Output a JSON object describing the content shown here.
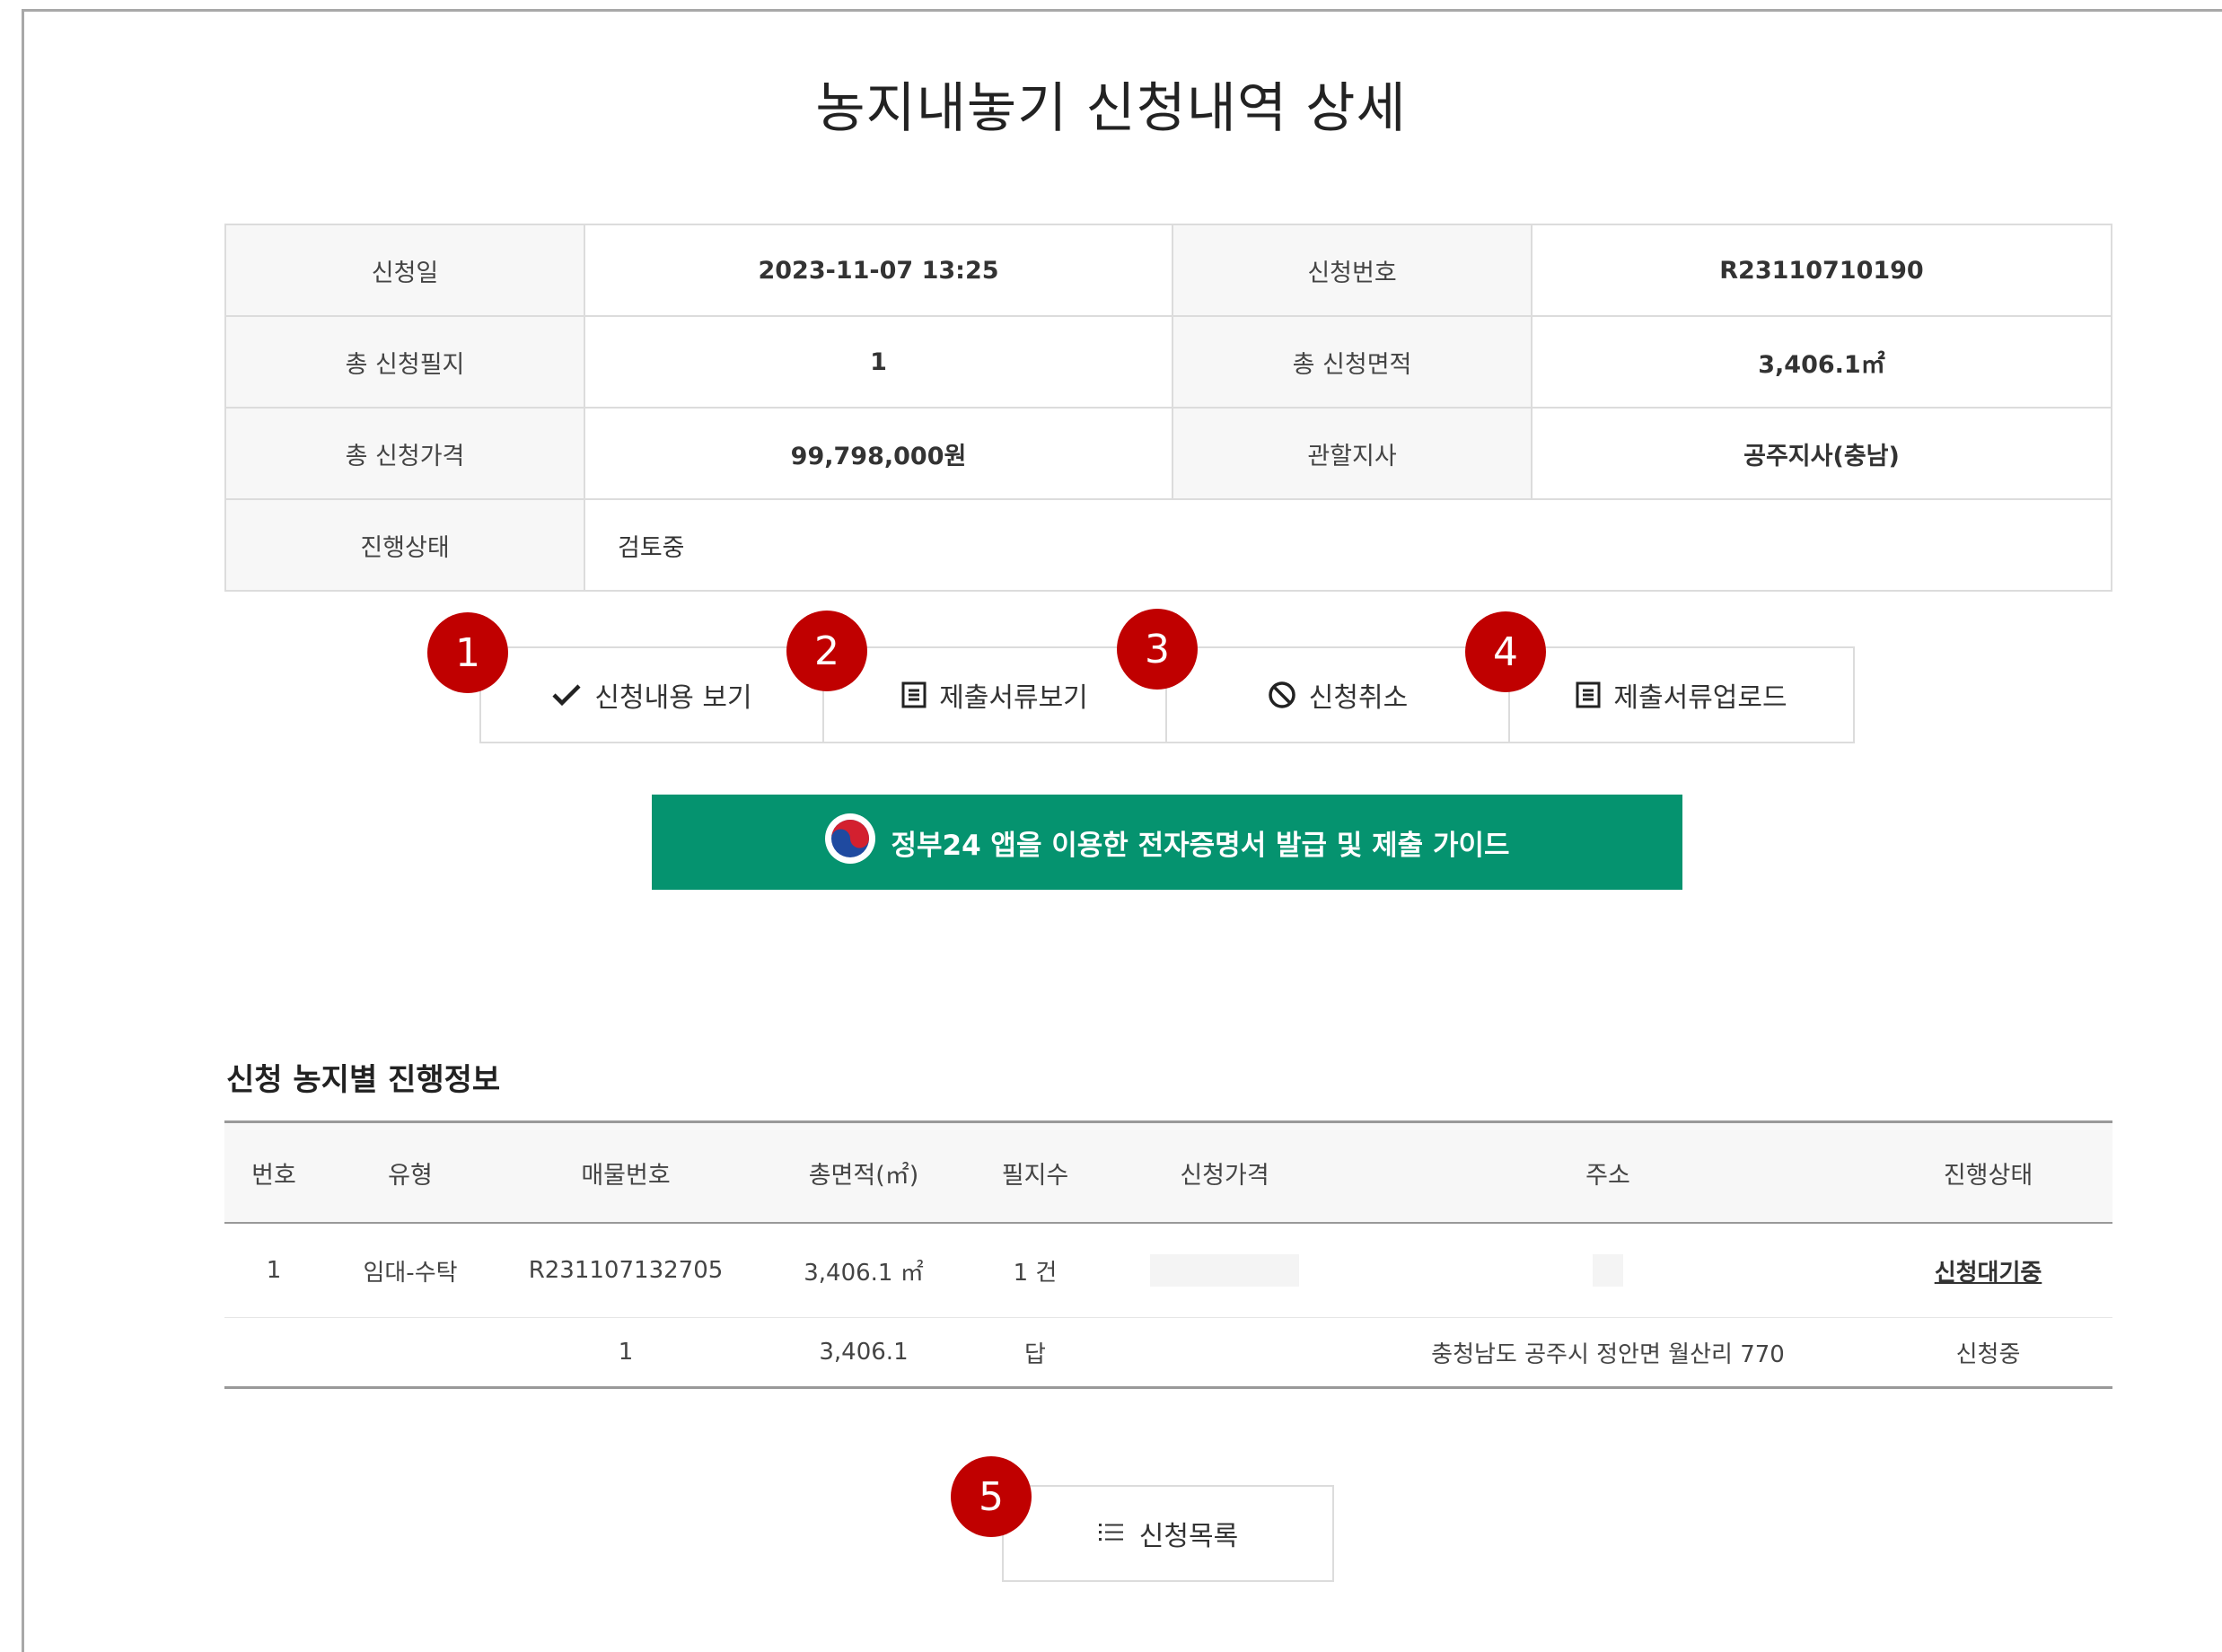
{
  "page": {
    "title": "농지내놓기 신청내역 상세"
  },
  "info": {
    "apply_date_label": "신청일",
    "apply_date": "2023-11-07 13:25",
    "apply_no_label": "신청번호",
    "apply_no": "R23110710190",
    "total_parcels_label": "총 신청필지",
    "total_parcels": "1",
    "total_area_label": "총 신청면적",
    "total_area": "3,406.1㎡",
    "total_price_label": "총 신청가격",
    "total_price": "99,798,000원",
    "branch_label": "관할지사",
    "branch": "공주지사(충남)",
    "status_label": "진행상태",
    "status": "검토중"
  },
  "actions": {
    "view_application": "신청내용 보기",
    "view_documents": "제출서류보기",
    "cancel_application": "신청취소",
    "upload_documents": "제출서류업로드"
  },
  "badges": [
    "1",
    "2",
    "3",
    "4",
    "5"
  ],
  "guide": {
    "label": "정부24 앱을 이용한 전자증명서 발급 및 제출 가이드"
  },
  "progress": {
    "title": "신청 농지별 진행정보",
    "headers": [
      "번호",
      "유형",
      "매물번호",
      "총면적(㎡)",
      "필지수",
      "신청가격",
      "주소",
      "진행상태"
    ],
    "row": {
      "no": "1",
      "type": "임대-수탁",
      "item_no": "R231107132705",
      "area": "3,406.1 ㎡",
      "parcels": "1 건",
      "status": "신청대기중"
    },
    "sub_row": {
      "item_no": "1",
      "area": "3,406.1",
      "land_type": "답",
      "address": "충청남도 공주시 정안면 월산리 770",
      "status": "신청중"
    }
  },
  "list_button": {
    "label": "신청목록"
  },
  "colors": {
    "badge": "#c00000",
    "guide_bg": "#05936f",
    "border": "#dcdcdc"
  }
}
